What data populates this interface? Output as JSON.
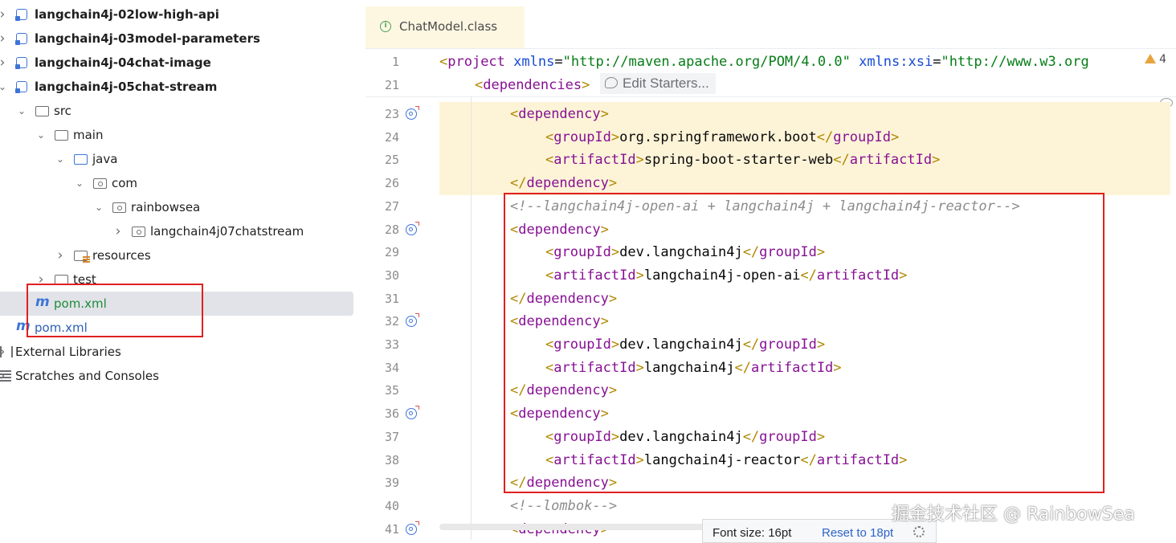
{
  "project_tree": {
    "items": [
      {
        "label": "langchain4j-02low-high-api",
        "icon": "module-icon",
        "bold": true,
        "chevron": "›"
      },
      {
        "label": "langchain4j-03model-parameters",
        "icon": "module-icon",
        "bold": true,
        "chevron": "›"
      },
      {
        "label": "langchain4j-04chat-image",
        "icon": "module-icon",
        "bold": true,
        "chevron": "›"
      },
      {
        "label": "langchain4j-05chat-stream",
        "icon": "module-icon",
        "bold": true,
        "chevron": "⌄"
      },
      {
        "label": "src",
        "icon": "folder-icon",
        "chevron": "⌄"
      },
      {
        "label": "main",
        "icon": "folder-icon",
        "chevron": "⌄"
      },
      {
        "label": "java",
        "icon": "source-folder-icon",
        "chevron": "⌄"
      },
      {
        "label": "com",
        "icon": "package-icon",
        "chevron": "⌄"
      },
      {
        "label": "rainbowsea",
        "icon": "package-icon",
        "chevron": "⌄"
      },
      {
        "label": "langchain4j07chatstream",
        "icon": "package-icon",
        "chevron": "›"
      },
      {
        "label": "resources",
        "icon": "resources-folder-icon",
        "chevron": "›"
      },
      {
        "label": "test",
        "icon": "folder-icon",
        "chevron": "›"
      },
      {
        "label": "pom.xml",
        "icon": "maven-icon",
        "selected": true
      },
      {
        "label": "pom.xml",
        "icon": "maven-icon"
      },
      {
        "label": "External Libraries",
        "icon": "library-icon",
        "chevron": "›"
      },
      {
        "label": "Scratches and Consoles",
        "icon": "scratches-icon",
        "chevron": "›"
      }
    ]
  },
  "editor": {
    "tab_label": "ChatModel.class",
    "warning_count": "4",
    "edit_starters": "Edit Starters...",
    "sticky_lines": [
      {
        "num": "1",
        "text": "<project xmlns=\"http://maven.apache.org/POM/4.0.0\" xmlns:xsi=\"http://www.w3.org"
      },
      {
        "num": "21",
        "text": "<dependencies>"
      }
    ],
    "lines": [
      {
        "num": "23",
        "text": "<dependency>",
        "indent": 2
      },
      {
        "num": "24",
        "text": "<groupId>org.springframework.boot</groupId>",
        "indent": 3
      },
      {
        "num": "25",
        "text": "<artifactId>spring-boot-starter-web</artifactId>",
        "indent": 3
      },
      {
        "num": "26",
        "text": "</dependency>",
        "indent": 2
      },
      {
        "num": "27",
        "text": "<!--langchain4j-open-ai + langchain4j + langchain4j-reactor-->",
        "indent": 2
      },
      {
        "num": "28",
        "text": "<dependency>",
        "indent": 2
      },
      {
        "num": "29",
        "text": "<groupId>dev.langchain4j</groupId>",
        "indent": 3
      },
      {
        "num": "30",
        "text": "<artifactId>langchain4j-open-ai</artifactId>",
        "indent": 3
      },
      {
        "num": "31",
        "text": "</dependency>",
        "indent": 2
      },
      {
        "num": "32",
        "text": "<dependency>",
        "indent": 2
      },
      {
        "num": "33",
        "text": "<groupId>dev.langchain4j</groupId>",
        "indent": 3
      },
      {
        "num": "34",
        "text": "<artifactId>langchain4j</artifactId>",
        "indent": 3
      },
      {
        "num": "35",
        "text": "</dependency>",
        "indent": 2
      },
      {
        "num": "36",
        "text": "<dependency>",
        "indent": 2
      },
      {
        "num": "37",
        "text": "<groupId>dev.langchain4j</groupId>",
        "indent": 3
      },
      {
        "num": "38",
        "text": "<artifactId>langchain4j-reactor</artifactId>",
        "indent": 3
      },
      {
        "num": "39",
        "text": "</dependency>",
        "indent": 2
      },
      {
        "num": "40",
        "text": "<!--lombok-->",
        "indent": 2
      },
      {
        "num": "41",
        "text": "<dependency>",
        "indent": 2
      }
    ]
  },
  "font_popup": {
    "size_label": "Font size: 16pt",
    "reset_label": "Reset to 18pt"
  },
  "watermark": "掘金技术社区 @ RainbowSea",
  "colors": {
    "tag_name": "#871094",
    "bracket": "#b08800",
    "attribute": "#174ad4",
    "string": "#067d17",
    "comment": "#8c8c8c",
    "highlight": "#fdf4d8",
    "annotation_box": "#e02020"
  }
}
